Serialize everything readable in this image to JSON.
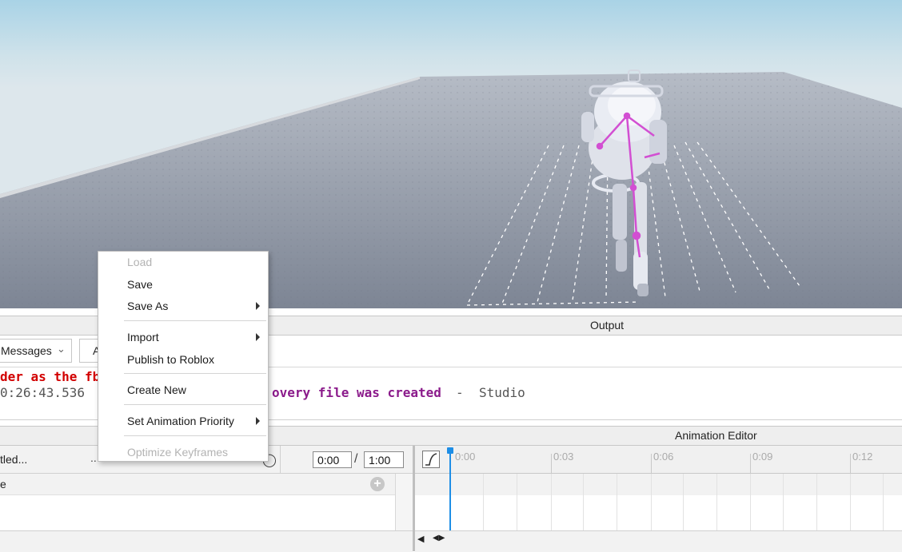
{
  "output": {
    "title": "Output",
    "message_filter": "Messages",
    "second_filter": "A",
    "lines": [
      {
        "text": "der as the fb",
        "color": "#d20000"
      },
      {
        "text": "0:26:43.536",
        "color": "#555555"
      }
    ],
    "recovery_text": "overy file was created",
    "recovery_color": "#8b1b8b",
    "separator": "-",
    "source": "Studio"
  },
  "animation_editor": {
    "title": "Animation Editor",
    "rig_name": "tled...",
    "more_dots": "...",
    "current_time": "0:00",
    "time_separator": "/",
    "end_time": "1:00",
    "track_label": "e",
    "ticks": [
      "0:00",
      "0:03",
      "0:06",
      "0:09",
      "0:12"
    ]
  },
  "context_menu": {
    "items": [
      {
        "label": "Load",
        "disabled": true,
        "submenu": false
      },
      {
        "label": "Save",
        "disabled": false,
        "submenu": false
      },
      {
        "label": "Save As",
        "disabled": false,
        "submenu": true
      },
      {
        "label": "Import",
        "disabled": false,
        "submenu": true
      },
      {
        "label": "Publish to Roblox",
        "disabled": false,
        "submenu": false
      },
      {
        "label": "Create New",
        "disabled": false,
        "submenu": false
      },
      {
        "label": "Set Animation Priority",
        "disabled": false,
        "submenu": true
      },
      {
        "label": "Optimize Keyframes",
        "disabled": true,
        "submenu": false
      }
    ]
  },
  "colors": {
    "accent": "#1e8ee6",
    "rig_highlight": "#d24fd2",
    "error_text": "#d20000"
  }
}
